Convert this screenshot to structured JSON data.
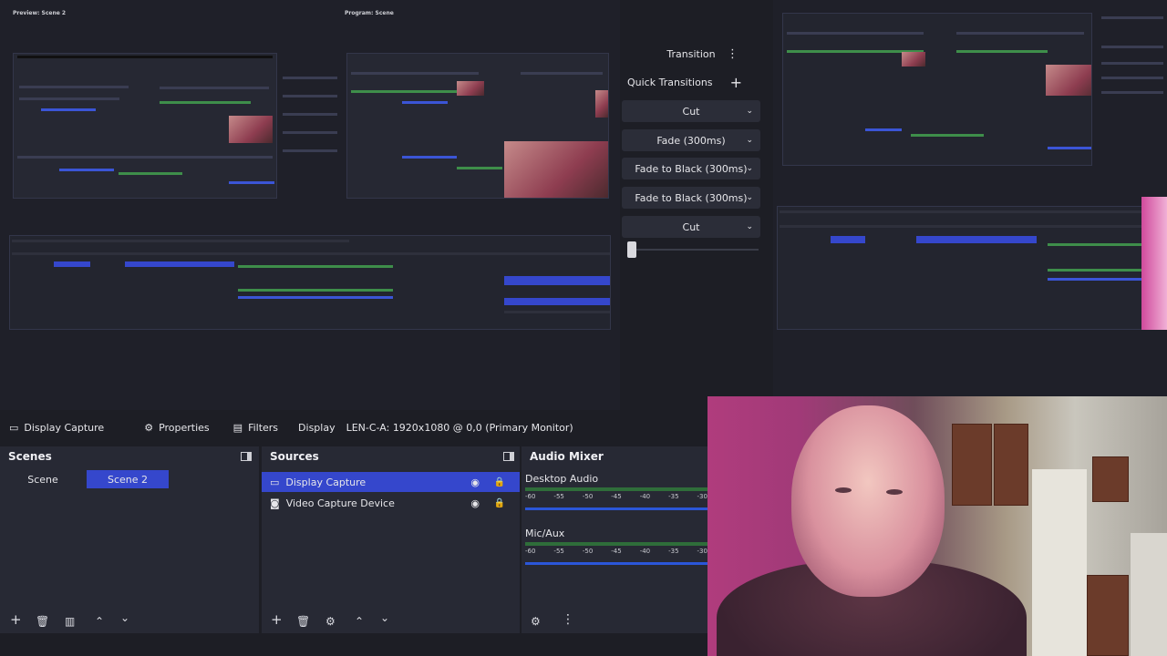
{
  "preview": {
    "preview_label": "Preview: Scene 2",
    "program_label": "Program: Scene"
  },
  "transitions": {
    "transition_label": "Transition",
    "quick_transitions_label": "Quick Transitions",
    "items": [
      "Cut",
      "Fade (300ms)",
      "Fade to Black (300ms)",
      "Fade to Black (300ms)",
      "Cut"
    ],
    "slider_level": 0
  },
  "source_toolbar": {
    "source_name": "Display Capture",
    "properties_label": "Properties",
    "filters_label": "Filters",
    "display_label": "Display",
    "display_value": "LEN-C-A: 1920x1080 @ 0,0 (Primary Monitor)"
  },
  "scenes": {
    "title": "Scenes",
    "items": [
      "Scene",
      "Scene 2"
    ],
    "selected": "Scene 2"
  },
  "sources": {
    "title": "Sources",
    "items": [
      "Display Capture",
      "Video Capture Device"
    ],
    "selected": "Display Capture"
  },
  "mixer": {
    "title": "Audio Mixer",
    "channels": [
      {
        "name": "Desktop Audio",
        "ticks": [
          "-60",
          "-55",
          "-50",
          "-45",
          "-40",
          "-35",
          "-30"
        ]
      },
      {
        "name": "Mic/Aux",
        "ticks": [
          "-60",
          "-55",
          "-50",
          "-45",
          "-40",
          "-35",
          "-30"
        ]
      }
    ]
  },
  "colors": {
    "selection": "#3547cc",
    "meter": "#2f6d3a",
    "volume": "#2b56d8"
  },
  "icons": {
    "add": "plus-icon",
    "remove": "trash-icon",
    "filter": "filter-icon",
    "up": "chevron-up-icon",
    "down": "chevron-down-icon",
    "settings": "gear-icon",
    "menu": "kebab-icon"
  }
}
